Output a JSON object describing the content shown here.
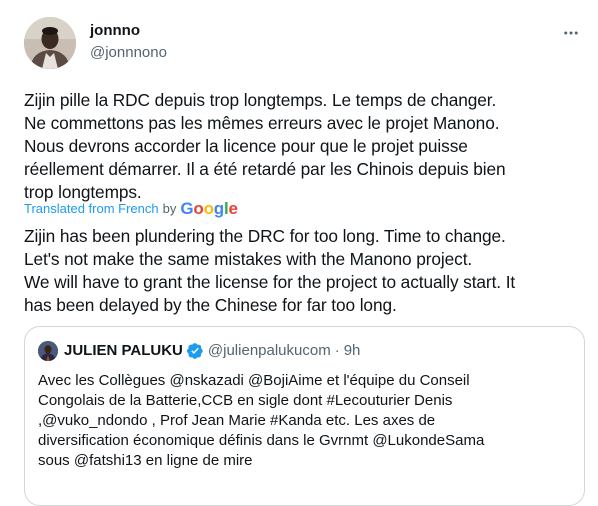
{
  "tweet": {
    "author": {
      "name": "jonnno",
      "handle": "@jonnnono"
    },
    "text_lines": [
      "Zijin pille la RDC depuis trop longtemps. Le temps de changer.",
      "Ne commettons pas les mêmes erreurs avec le projet Manono.",
      "Nous devrons accorder la licence pour que le projet puisse",
      "réellement démarrer. Il a été retardé par les Chinois depuis bien",
      "trop longtemps."
    ],
    "translation_notice": {
      "link_text": "Translated from French",
      "by_text": "by",
      "provider": "Google"
    },
    "translation_lines": [
      "Zijin has been plundering the DRC for too long. Time to change.",
      "Let's not make the same mistakes with the Manono project.",
      "We will have to grant the license for the project to actually start. It",
      "has been delayed by the Chinese for far too long."
    ]
  },
  "quoted_tweet": {
    "author": {
      "name": "JULIEN PALUKU",
      "handle": "@julienpalukucom",
      "separator": "·",
      "time": "9h"
    },
    "text_lines": [
      "Avec les Collègues @nskazadi @BojiAime et l'équipe du Conseil",
      "Congolais de la Batterie,CCB en sigle dont #Lecouturier Denis",
      ",@vuko_ndondo , Prof Jean Marie #Kanda etc. Les axes de",
      "diversification économique définis dans le Gvrnmt @LukondeSama",
      "sous @fatshi13 en ligne de mire"
    ]
  },
  "colors": {
    "text": "#0f1419",
    "secondary": "#536471",
    "link": "#1d9bf0",
    "border": "#cfd9de",
    "verified": "#1d9bf0"
  },
  "icons": {
    "more": "more-horizontal-icon",
    "verified": "verified-badge-icon"
  }
}
